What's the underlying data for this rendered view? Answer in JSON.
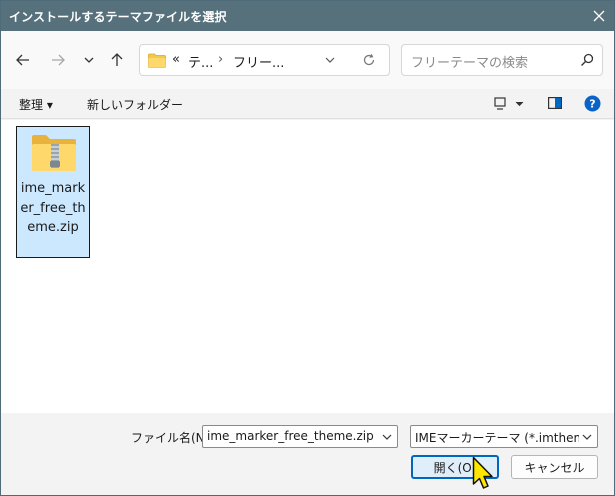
{
  "window": {
    "title": "インストールするテーマファイルを選択"
  },
  "nav": {
    "breadcrumbs": [
      "«",
      "テ...",
      "›",
      "フリー..."
    ],
    "search_placeholder": "フリーテーマの検索"
  },
  "commandbar": {
    "organize_label": "整理 ▾",
    "new_folder_label": "新しいフォルダー"
  },
  "files": [
    {
      "name": "ime_marker_free_theme.zip",
      "selected": true,
      "icon": "zip-folder-icon"
    }
  ],
  "bottom": {
    "filename_label": "ファイル名(N):",
    "filename_value": "ime_marker_free_theme.zip",
    "filter_value": "IMEマーカーテーマ (*.imtheme; *.zi",
    "open_label": "開く(O)",
    "cancel_label": "キャンセル"
  },
  "colors": {
    "titlebar": "#56717c",
    "accent": "#0067c0",
    "selection": "#cce8ff",
    "help": "#0a64c8",
    "folder": "#f2c94c"
  }
}
